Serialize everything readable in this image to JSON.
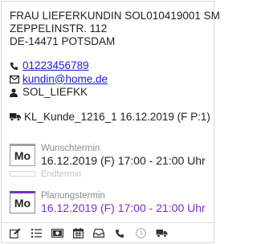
{
  "address": {
    "line1": "FRAU LIEFERKUNDIN SOL010419001 SM",
    "line2": "ZEPPELINSTR. 112",
    "line3": "DE-14471 POTSDAM"
  },
  "contact": {
    "phone": "01223456789",
    "email": "kundin@home.de",
    "user": "SOL_LIEFKK"
  },
  "shipment": "KL_Kunde_1216_1 16.12.2019 (F P:1)",
  "wish_appointment": {
    "day": "Mo",
    "label": "Wunschtermin",
    "value": "16.12.2019 (F) 17:00 - 21:00 Uhr",
    "end_label": "Endtermin"
  },
  "planned_appointment": {
    "day": "Mo",
    "label": "Planungstermin",
    "value": "16.12.2019 (F) 17:00 - 21:00 Uhr",
    "color": "#7b2fc7"
  },
  "toolbar": [
    "edit-icon",
    "list-icon",
    "money-icon",
    "calendar-icon",
    "inbox-icon",
    "phone-icon",
    "clock-icon",
    "truck-icon"
  ]
}
